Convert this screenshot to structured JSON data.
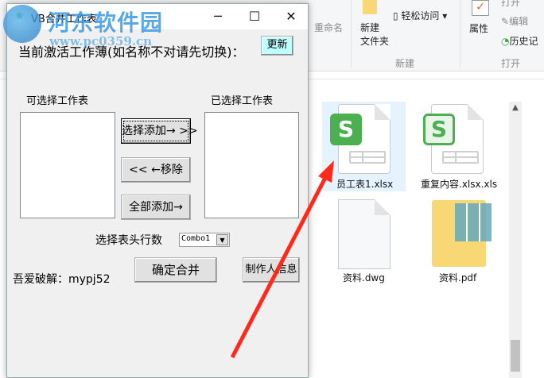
{
  "explorer": {
    "ribbon": {
      "rename": "重命名",
      "new_folder_line1": "新建",
      "new_folder_line2": "文件夹",
      "easy_access": "轻松访问",
      "new_group": "新建",
      "properties": "属性",
      "open": "打开",
      "edit": "编辑",
      "history": "历史记",
      "open_group": "打开"
    },
    "files": [
      {
        "name": "员工表1.xlsx"
      },
      {
        "name": "重复内容.xlsx.xls"
      },
      {
        "name": "资料.dwg"
      },
      {
        "name": "资料.pdf"
      }
    ],
    "colors": {
      "excel_green": "#4caf50",
      "selection": "#e5f3ff",
      "folder": "#f8d775"
    }
  },
  "dialog": {
    "title": "VB合并工作表",
    "active_label": "当前激活工作薄(如名称不对请先切换)：",
    "refresh": "更新",
    "available_label": "可选择工作表",
    "selected_label": "已选择工作表",
    "add_selected": "选择添加→ >>",
    "remove": "<< ←移除",
    "add_all": "全部添加→",
    "header_rows_label": "选择表头行数",
    "combo_value": "Combo1",
    "credit": "吾爱破解：mypj52",
    "merge": "确定合并",
    "author_info": "制作人信息"
  },
  "watermark": {
    "name": "河东软件园",
    "url": "www.pc0359.cn"
  }
}
